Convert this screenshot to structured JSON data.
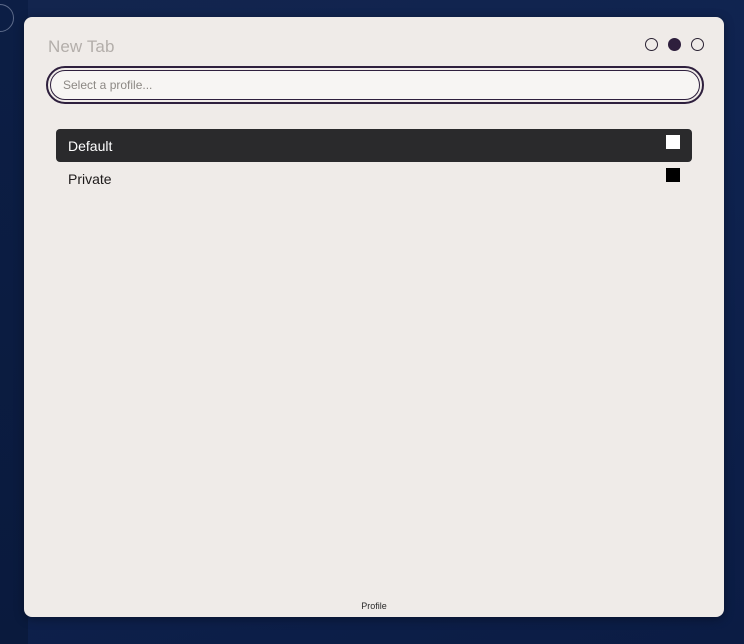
{
  "panel": {
    "title": "New Tab",
    "footer": "Profile"
  },
  "dots": [
    {
      "name": "dot-1",
      "state": "empty"
    },
    {
      "name": "dot-2",
      "state": "filled"
    },
    {
      "name": "dot-3",
      "state": "empty"
    }
  ],
  "search": {
    "placeholder": "Select a profile...",
    "value": ""
  },
  "profiles": [
    {
      "label": "Default",
      "selected": true,
      "swatch_color": "#ffffff"
    },
    {
      "label": "Private",
      "selected": false,
      "swatch_color": "#000000"
    }
  ],
  "colors": {
    "accent": "#2e1f3d",
    "panel_bg": "#efebe8",
    "selected_bg": "#2a2a2c",
    "background": "#0f2350"
  }
}
